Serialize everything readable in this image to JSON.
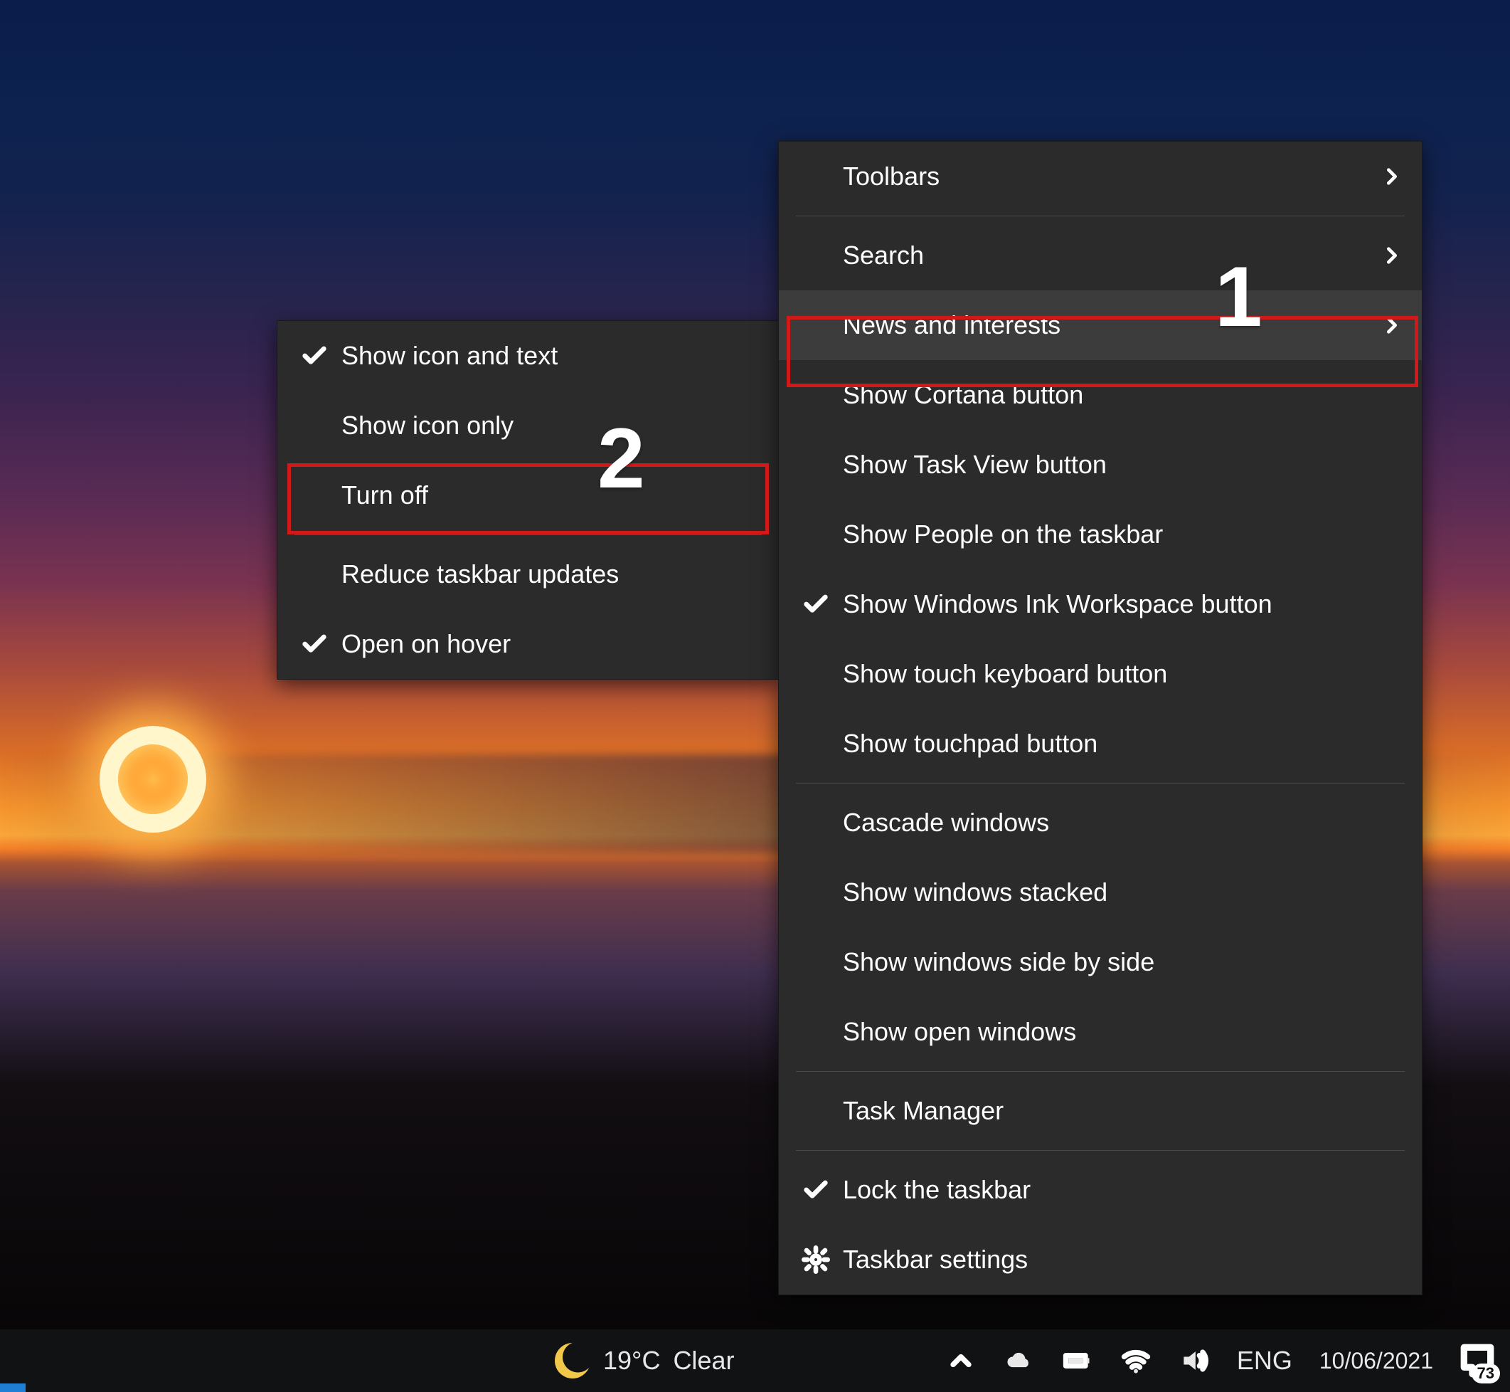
{
  "annotations": {
    "callout1": "1",
    "callout2": "2"
  },
  "primary_menu": {
    "toolbars": "Toolbars",
    "search": "Search",
    "news": "News and interests",
    "cortana": "Show Cortana button",
    "taskview": "Show Task View button",
    "people": "Show People on the taskbar",
    "ink": "Show Windows Ink Workspace button",
    "touchkb": "Show touch keyboard button",
    "touchpad": "Show touchpad button",
    "cascade": "Cascade windows",
    "stacked": "Show windows stacked",
    "sidebyside": "Show windows side by side",
    "openwin": "Show open windows",
    "taskmgr": "Task Manager",
    "lock": "Lock the taskbar",
    "settings": "Taskbar settings"
  },
  "secondary_menu": {
    "icon_text": "Show icon and text",
    "icon_only": "Show icon only",
    "turn_off": "Turn off",
    "reduce": "Reduce taskbar updates",
    "hover": "Open on hover"
  },
  "taskbar": {
    "temp": "19°C",
    "condition": "Clear",
    "lang": "ENG",
    "date": "10/06/2021",
    "notif_count": "73"
  }
}
